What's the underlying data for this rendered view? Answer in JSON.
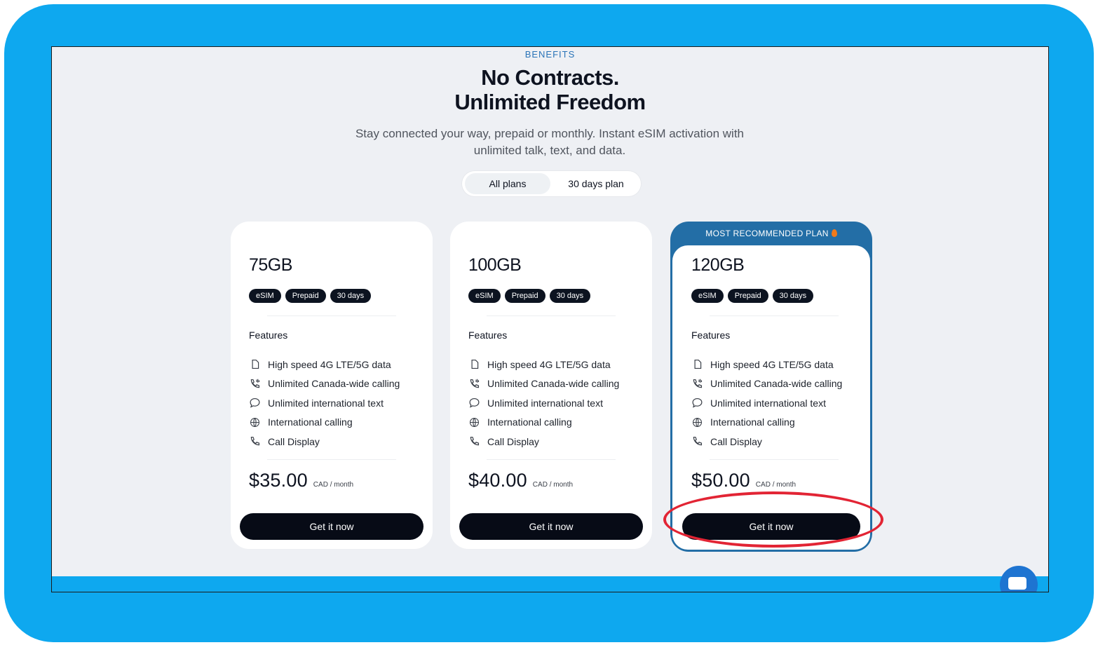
{
  "header": {
    "eyebrow": "BENEFITS",
    "title_line1": "No Contracts.",
    "title_line2": "Unlimited Freedom",
    "subtitle": "Stay connected your way, prepaid or monthly. Instant eSIM activation with unlimited talk, text, and data."
  },
  "toggle": {
    "options": [
      "All plans",
      "30 days plan"
    ],
    "selected": "All plans"
  },
  "recommended_label": "MOST RECOMMENDED PLAN",
  "plans": [
    {
      "name": "75GB",
      "tags": [
        "eSIM",
        "Prepaid",
        "30 days"
      ],
      "features_heading": "Features",
      "features": [
        "High speed 4G LTE/5G data",
        "Unlimited Canada-wide calling",
        "Unlimited international text",
        "International calling",
        "Call Display"
      ],
      "price": "$35.00",
      "price_unit": "CAD / month",
      "cta": "Get it now"
    },
    {
      "name": "100GB",
      "tags": [
        "eSIM",
        "Prepaid",
        "30 days"
      ],
      "features_heading": "Features",
      "features": [
        "High speed 4G LTE/5G data",
        "Unlimited Canada-wide calling",
        "Unlimited international text",
        "International calling",
        "Call Display"
      ],
      "price": "$40.00",
      "price_unit": "CAD / month",
      "cta": "Get it now"
    },
    {
      "name": "120GB",
      "tags": [
        "eSIM",
        "Prepaid",
        "30 days"
      ],
      "features_heading": "Features",
      "features": [
        "High speed 4G LTE/5G data",
        "Unlimited Canada-wide calling",
        "Unlimited international text",
        "International calling",
        "Call Display"
      ],
      "price": "$50.00",
      "price_unit": "CAD / month",
      "cta": "Get it now"
    }
  ],
  "icons": [
    "sim-icon",
    "phone-wave-icon",
    "chat-icon",
    "globe-icon",
    "phone-icon",
    "fire-icon",
    "chat-bubble-icon"
  ],
  "colors": {
    "frame": "#0ea8ef",
    "page_bg": "#eef0f4",
    "accent_blue": "#236ea6",
    "button": "#070b16",
    "highlight": "#e22434"
  }
}
